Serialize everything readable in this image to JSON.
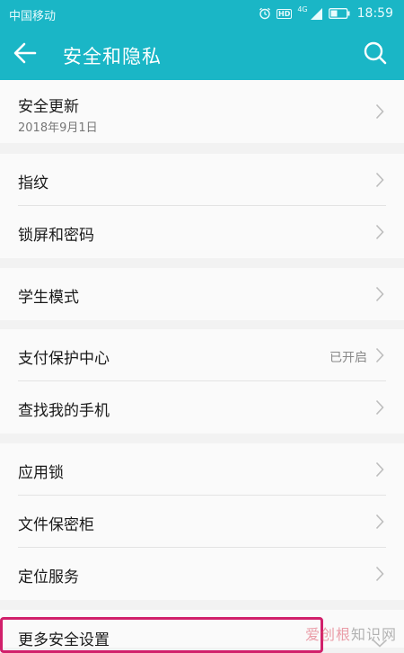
{
  "status_bar": {
    "carrier": "中国移动",
    "hd_badge": "HD",
    "network": "4G",
    "time": "18:59"
  },
  "header": {
    "title": "安全和隐私",
    "back_icon": "back-arrow-icon",
    "search_icon": "search-icon"
  },
  "groups": [
    {
      "items": [
        {
          "label": "安全更新",
          "sub": "2018年9月1日"
        }
      ]
    },
    {
      "items": [
        {
          "label": "指纹"
        },
        {
          "label": "锁屏和密码"
        }
      ]
    },
    {
      "items": [
        {
          "label": "学生模式"
        }
      ]
    },
    {
      "items": [
        {
          "label": "支付保护中心",
          "value": "已开启"
        },
        {
          "label": "查找我的手机"
        }
      ]
    },
    {
      "items": [
        {
          "label": "应用锁"
        },
        {
          "label": "文件保密柜"
        },
        {
          "label": "定位服务"
        }
      ]
    },
    {
      "items": [
        {
          "label": "更多安全设置"
        }
      ]
    }
  ],
  "watermark": {
    "brand": "爱创根",
    "suffix": "知识网"
  },
  "colors": {
    "accent": "#1ab6c6",
    "highlight": "#d1206b",
    "background": "#f2f2f2"
  }
}
